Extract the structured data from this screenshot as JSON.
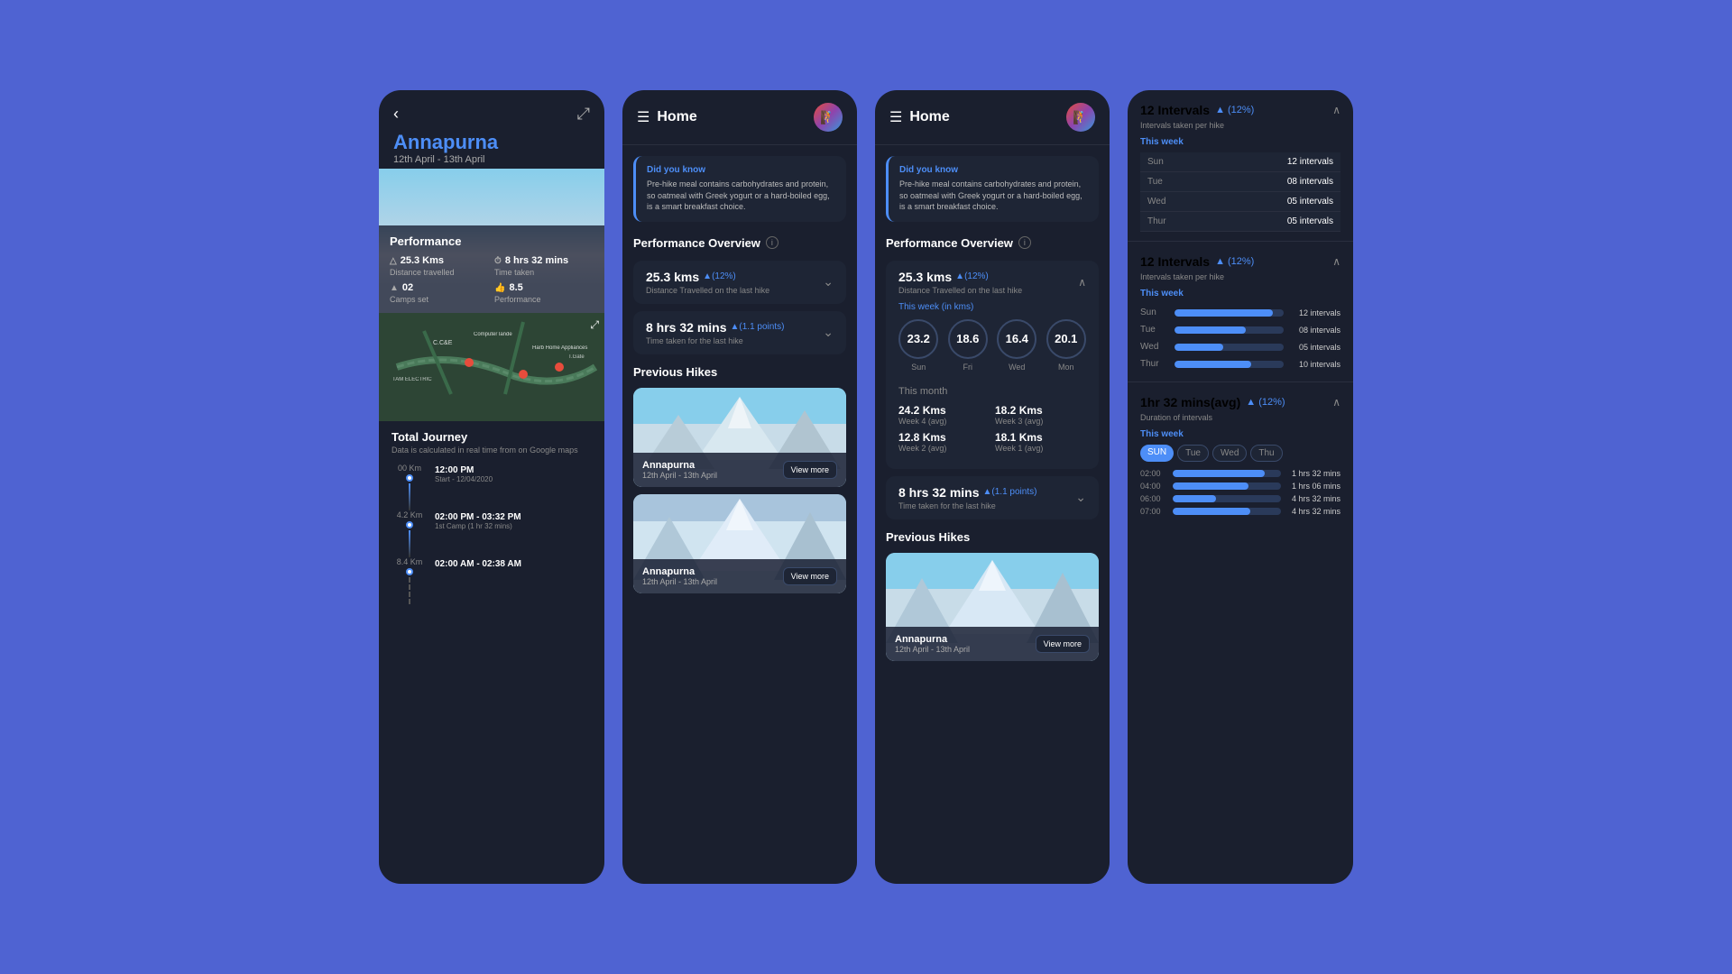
{
  "app": {
    "bg_color": "#4f63d2"
  },
  "card1": {
    "back_label": "‹",
    "share_label": "⋯",
    "title": "Annapurna",
    "date_range": "12th April - 13th April",
    "perf_label": "Performance",
    "distance_val": "25.3 Kms",
    "distance_label": "Distance travelled",
    "time_val": "8 hrs 32 mins",
    "time_label": "Time taken",
    "camps_val": "02",
    "camps_label": "Camps set",
    "perf_val": "8.5",
    "perf_label2": "Performance",
    "total_journey": "Total Journey",
    "journey_sub": "Data is calculated in real time from on Google maps",
    "timeline": [
      {
        "km": "00 Km",
        "time": "12:00 PM",
        "desc": "Start - 12/04/2020"
      },
      {
        "km": "4.2 Km",
        "time": "02:00 PM - 03:32 PM",
        "desc": "1st Camp (1 hr 32 mins)"
      },
      {
        "km": "8.4 Km",
        "time": "02:00 AM - 02:38 AM",
        "desc": ""
      }
    ]
  },
  "card2": {
    "home_title": "Home",
    "did_you_know": "Did you know",
    "info_text": "Pre-hike meal contains carbohydrates and protein, so oatmeal with Greek yogurt or a hard-boiled egg, is a smart breakfast choice.",
    "perf_overview": "Performance Overview",
    "distance_metric": "25.3 kms",
    "distance_arrow": "▲(12%)",
    "distance_sub": "Distance Travelled on the last hike",
    "time_metric": "8 hrs 32 mins",
    "time_arrow": "▲(1.1 points)",
    "time_sub": "Time taken for the last hike",
    "prev_hikes": "Previous Hikes",
    "hike1_name": "Annapurna",
    "hike1_date": "12th April - 13th April",
    "hike1_btn": "View more",
    "hike2_name": "Annapurna",
    "hike2_date": "12th April - 13th April",
    "hike2_btn": "View more"
  },
  "card3": {
    "home_title": "Home",
    "did_you_know": "Did you know",
    "info_text": "Pre-hike meal contains carbohydrates and protein, so oatmeal with Greek yogurt or a hard-boiled egg, is a smart breakfast choice.",
    "perf_overview": "Performance Overview",
    "distance_metric": "25.3 kms",
    "distance_arrow": "▲(12%)",
    "distance_sub": "Distance Travelled on the last hike",
    "this_week_label": "This week (in kms)",
    "circles": [
      {
        "val": "23.2",
        "day": "Sun"
      },
      {
        "val": "18.6",
        "day": "Fri"
      },
      {
        "val": "16.4",
        "day": "Wed"
      },
      {
        "val": "20.1",
        "day": "Mon"
      }
    ],
    "this_month": "This month",
    "month_stats": [
      {
        "val": "24.2 Kms",
        "label": "Week 4 (avg)"
      },
      {
        "val": "18.2 Kms",
        "label": "Week 3 (avg)"
      },
      {
        "val": "12.8 Kms",
        "label": "Week 2 (avg)"
      },
      {
        "val": "18.1 Kms",
        "label": "Week 1 (avg)"
      }
    ],
    "time_metric": "8 hrs 32 mins",
    "time_arrow": "▲(1.1 points)",
    "time_sub": "Time taken for the last hike",
    "prev_hikes": "Previous Hikes",
    "hike_name": "Annapurna",
    "hike_date": "12th April - 13th April",
    "hike_btn": "View more"
  },
  "card4": {
    "section1": {
      "title": "12 Intervals",
      "badge": "▲ (12%)",
      "sub": "Intervals taken per hike",
      "this_week": "This week",
      "rows": [
        {
          "day": "Sun",
          "val": "12 intervals"
        },
        {
          "day": "Tue",
          "val": "08 intervals"
        },
        {
          "day": "Wed",
          "val": "05 intervals"
        },
        {
          "day": "Thur",
          "val": "05 intervals"
        }
      ]
    },
    "section2": {
      "title": "12 Intervals",
      "badge": "▲ (12%)",
      "sub": "Intervals taken per hike",
      "this_week": "This week",
      "bars": [
        {
          "day": "Sun",
          "pct": 90,
          "val": "12 intervals"
        },
        {
          "day": "Tue",
          "pct": 65,
          "val": "08 intervals"
        },
        {
          "day": "Wed",
          "pct": 45,
          "val": "05 intervals"
        },
        {
          "day": "Thur",
          "pct": 70,
          "val": "10 intervals"
        }
      ]
    },
    "section3": {
      "title": "1hr 32 mins(avg)",
      "badge": "▲ (12%)",
      "sub": "Duration of intervals",
      "this_week": "This week",
      "tabs": [
        "SUN",
        "Tue",
        "Wed",
        "Thu"
      ],
      "active_tab": 0,
      "time_bars": [
        {
          "time": "02:00",
          "pct": 85,
          "val": "1 hrs 32 mins"
        },
        {
          "time": "04:00",
          "pct": 70,
          "val": "1 hrs 06 mins"
        },
        {
          "time": "06:00",
          "pct": 40,
          "val": "4 hrs 32 mins"
        },
        {
          "time": "07:00",
          "pct": 72,
          "val": "4 hrs 32 mins"
        }
      ]
    }
  }
}
